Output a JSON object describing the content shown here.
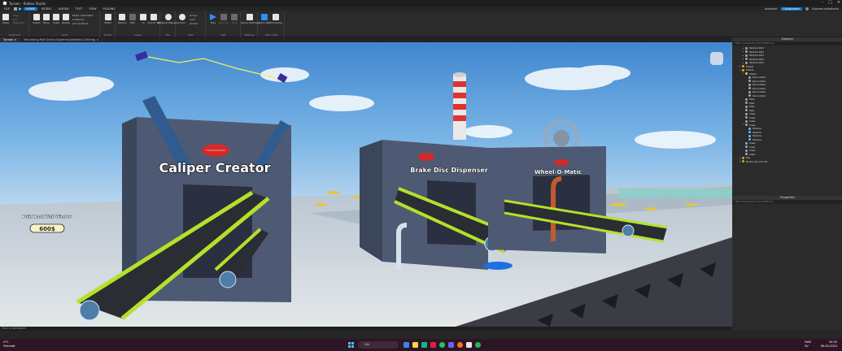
{
  "window": {
    "title": "Tycoon - Roblox Studio"
  },
  "menu": {
    "file": "FILE",
    "tabs": [
      "HOME",
      "MODEL",
      "AVATAR",
      "TEST",
      "VIEW",
      "PLUGINS"
    ],
    "assistant": "Assistant",
    "collaborate": "Collaborate",
    "user": "Supermucbfeitonlu"
  },
  "ribbon": {
    "clipboard": {
      "label": "Clipboard",
      "paste": "Paste",
      "copy": "Copy",
      "cut": "Cut",
      "duplicate": "Duplicate"
    },
    "tools": {
      "label": "Tools",
      "select": "Select",
      "move": "Move",
      "scale": "Scale",
      "rotate": "Rotate",
      "mode_label": "Mode:",
      "mode_value": "Geometric",
      "collisions": "Collisions",
      "join_surfaces": "Join Surfaces"
    },
    "terrain": {
      "label": "Terrain",
      "editor": "Editor"
    },
    "insert": {
      "label": "Insert",
      "toolbox": "Toolbox",
      "part": "Part",
      "ui": "UI",
      "import3d": "Import 3D"
    },
    "file": {
      "label": "File",
      "material_manager": "Material Manager"
    },
    "edit": {
      "label": "Edit",
      "color": "Color",
      "group": "Group",
      "lock": "Lock",
      "anchor": "Anchor"
    },
    "test": {
      "label": "Test",
      "play": "Play",
      "resume": "Resume",
      "stop": "Stop"
    },
    "settings": {
      "label": "Settings",
      "game_settings": "Game Settings"
    },
    "team_test": {
      "label": "Team Test",
      "team_test": "Team Test",
      "exit_game": "Exit Game"
    }
  },
  "tabs": [
    {
      "label": "Tycoon",
      "active": true
    },
    {
      "label": "Mountaing Part Script (Supermucbfeitonlu Editing)",
      "active": false
    }
  ],
  "scene": {
    "machine1": "Caliper Creator",
    "machine2": "Brake Disc Dispenser",
    "machine3": "Wheel-O-Matic",
    "buy_button_title": "Build Back Wall\nWindow",
    "buy_button_price": "600$"
  },
  "explorer": {
    "title": "Explorer",
    "filter": "Filter workspace (Ctrl+Shift+X)",
    "items": [
      {
        "label": "Texture Part",
        "indent": 2,
        "icon": "part",
        "arrow": "▸"
      },
      {
        "label": "Texture Part",
        "indent": 2,
        "icon": "part",
        "arrow": "▸"
      },
      {
        "label": "Texture Part",
        "indent": 2,
        "icon": "part",
        "arrow": "▸"
      },
      {
        "label": "Texture Part",
        "indent": 2,
        "icon": "part",
        "arrow": "▸"
      },
      {
        "label": "Texture Part",
        "indent": 2,
        "icon": "part",
        "arrow": "▸"
      },
      {
        "label": "Model",
        "indent": 1,
        "icon": "model",
        "arrow": "▸"
      },
      {
        "label": "Model",
        "indent": 1,
        "icon": "model",
        "arrow": "▾"
      },
      {
        "label": "Folder",
        "indent": 2,
        "icon": "folder",
        "arrow": "▾"
      },
      {
        "label": "Decoration",
        "indent": 3,
        "icon": "part",
        "arrow": ""
      },
      {
        "label": "Decoration",
        "indent": 3,
        "icon": "part",
        "arrow": ""
      },
      {
        "label": "Decoration",
        "indent": 3,
        "icon": "part",
        "arrow": ""
      },
      {
        "label": "Decoration",
        "indent": 3,
        "icon": "part",
        "arrow": ""
      },
      {
        "label": "Decoration",
        "indent": 3,
        "icon": "part",
        "arrow": ""
      },
      {
        "label": "Decoration",
        "indent": 3,
        "icon": "part",
        "arrow": ""
      },
      {
        "label": "Pipe",
        "indent": 2,
        "icon": "part",
        "arrow": ""
      },
      {
        "label": "Pipe",
        "indent": 2,
        "icon": "part",
        "arrow": ""
      },
      {
        "label": "Pipe",
        "indent": 2,
        "icon": "part",
        "arrow": ""
      },
      {
        "label": "Pipe",
        "indent": 2,
        "icon": "part",
        "arrow": ""
      },
      {
        "label": "Case",
        "indent": 2,
        "icon": "part",
        "arrow": ""
      },
      {
        "label": "Case",
        "indent": 2,
        "icon": "part",
        "arrow": ""
      },
      {
        "label": "Case",
        "indent": 2,
        "icon": "part",
        "arrow": ""
      },
      {
        "label": "Case",
        "indent": 2,
        "icon": "part",
        "arrow": "▾"
      },
      {
        "label": "Texture",
        "indent": 3,
        "icon": "texture",
        "arrow": ""
      },
      {
        "label": "Texture",
        "indent": 3,
        "icon": "texture",
        "arrow": ""
      },
      {
        "label": "Texture",
        "indent": 3,
        "icon": "texture",
        "arrow": ""
      },
      {
        "label": "Texture",
        "indent": 3,
        "icon": "texture",
        "arrow": ""
      },
      {
        "label": "Case",
        "indent": 2,
        "icon": "part",
        "arrow": ""
      },
      {
        "label": "Case",
        "indent": 2,
        "icon": "part",
        "arrow": ""
      },
      {
        "label": "Case",
        "indent": 2,
        "icon": "part",
        "arrow": ""
      },
      {
        "label": "Case",
        "indent": 2,
        "icon": "part",
        "arrow": ""
      },
      {
        "label": "Rig",
        "indent": 1,
        "icon": "model",
        "arrow": "▸"
      },
      {
        "label": "Rodo's Tycoon Kit",
        "indent": 1,
        "icon": "model",
        "arrow": "▸"
      }
    ]
  },
  "properties": {
    "title": "Properties",
    "filter": "Filter Properties (Ctrl+Shift+P)"
  },
  "command_bar": {
    "placeholder": "Run a command"
  },
  "taskbar": {
    "temperature": "4°C",
    "condition": "Ylimmät",
    "search": "Sök",
    "lang": "SWE",
    "lang2": "SV",
    "time": "20:32",
    "date": "06-05-2024"
  },
  "colors": {
    "accent": "#0b78d8",
    "sky": "#62a3df",
    "machine": "#4e5a73",
    "conveyor_belt": "#2a2d33",
    "conveyor_rim": "#b5e02a"
  }
}
